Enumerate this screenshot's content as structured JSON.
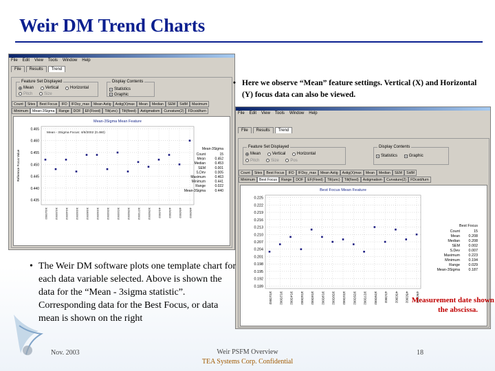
{
  "slide": {
    "title": "Weir DM Trend Charts",
    "bullet_right": "Here we observe “Mean” feature settings. Vertical (X) and Horizontal (Y) focus data can also be viewed.",
    "bullet_left": "The Weir DM software plots one template chart for each data variable selected. Above is shown the data for the “Mean - 3sigma statistic”. Corresponding data for the Best Focus, or data mean is shown on the right",
    "measurement_note": "Measurement date shown on the abscissa.",
    "bullet_glyph": "•"
  },
  "footer": {
    "date": "Nov. 2003",
    "center_line1": "Weir PSFM Overview",
    "center_line2": "TEA Systems Corp. Confidential",
    "page": "18"
  },
  "app_window": {
    "menu": [
      "File",
      "Edit",
      "View",
      "Tools",
      "Window",
      "Help"
    ],
    "tabs": [
      "File",
      "Results",
      "Trend"
    ],
    "active_tab": "Trend",
    "panel_label": "Trend Charts",
    "feature_group": {
      "label": "Feature Set Displayed",
      "options": [
        "Mean",
        "Vertical",
        "Horizontal",
        "Pitch",
        "Size",
        "Pos"
      ],
      "selected": "Mean"
    },
    "display_group": {
      "label": "Display Contents",
      "options": [
        "Statistics",
        "Graphic"
      ]
    },
    "variable_tabs_row1": [
      "Count",
      "Sites",
      "Best Focus",
      "IFD",
      "IFDsy_max",
      "Mean Astig",
      "Astig(X)max",
      "Mean",
      "Median",
      "SEM",
      "SidM",
      "Maximum"
    ],
    "variable_tabs_row2": [
      "Minimum",
      "Mean-3Sigma",
      "Range",
      "DOF",
      "EF(Fixed)",
      "Tilt(unc)",
      "Tilt(fixed)",
      "Astigmatism",
      "Curvature(2)",
      "FDcsid/turn"
    ]
  },
  "left_chart": {
    "title": "Mean-3Sigma Mean Feature",
    "annotation": "Mean - 3Sigma Focus: 4/6/2002 (0.460)",
    "stats_header": "Mean-3Sigma",
    "stats": [
      {
        "label": "Count",
        "value": "15"
      },
      {
        "label": "Mean",
        "value": "0.452"
      },
      {
        "label": "Median",
        "value": "0.453"
      },
      {
        "label": "SEM",
        "value": "0.001"
      },
      {
        "label": "S.Dev",
        "value": "0.005"
      },
      {
        "label": "Maximum",
        "value": "0.463"
      },
      {
        "label": "Minimum",
        "value": "0.441"
      },
      {
        "label": "Range",
        "value": "0.022"
      },
      {
        "label": "Mean-3Sigma",
        "value": "0.440"
      }
    ]
  },
  "right_chart": {
    "title": "Best Focus Mean Feature",
    "stats_header": "Best Focus",
    "stats": [
      {
        "label": "Count",
        "value": "15"
      },
      {
        "label": "Mean",
        "value": "0.208"
      },
      {
        "label": "Median",
        "value": "0.208"
      },
      {
        "label": "SEM",
        "value": "0.002"
      },
      {
        "label": "S.Dev",
        "value": "0.007"
      },
      {
        "label": "Maximum",
        "value": "0.223"
      },
      {
        "label": "Minimum",
        "value": "0.194"
      },
      {
        "label": "Range",
        "value": "0.029"
      },
      {
        "label": "Mean-3Sigma",
        "value": "0.187"
      }
    ]
  },
  "chart_data": [
    {
      "type": "scatter",
      "title": "Mean-3Sigma Mean Feature",
      "ylabel": "Reference Focus Value",
      "ylim": [
        0.433,
        0.466
      ],
      "yticks": [
        "0.465",
        "0.460",
        "0.455",
        "0.450",
        "0.445",
        "0.440",
        "0.435"
      ],
      "x": [
        "3/11/2002",
        "3/12/2002",
        "3/14/2002",
        "3/15/2002",
        "3/18/2002",
        "3/19/2002",
        "3/20/2002",
        "3/22/2002",
        "3/25/2002",
        "3/27/2002",
        "3/29/2002",
        "4/1/2002",
        "4/3/2002",
        "4/5/2002",
        "4/6/2002"
      ],
      "y": [
        0.452,
        0.448,
        0.452,
        0.447,
        0.454,
        0.454,
        0.448,
        0.455,
        0.447,
        0.451,
        0.449,
        0.452,
        0.454,
        0.45,
        0.46
      ],
      "grid": true
    },
    {
      "type": "scatter",
      "title": "Best Focus Mean Feature",
      "ylim": [
        0.188,
        0.226
      ],
      "yticks": [
        "0.225",
        "0.222",
        "0.219",
        "0.216",
        "0.213",
        "0.210",
        "0.207",
        "0.204",
        "0.201",
        "0.198",
        "0.195",
        "0.192",
        "0.189"
      ],
      "x": [
        "3/11/2002",
        "3/12/2002",
        "3/14/2002",
        "3/15/2002",
        "3/18/2002",
        "3/19/2002",
        "3/20/2002",
        "3/22/2002",
        "3/25/2002",
        "3/27/2002",
        "3/29/2002",
        "4/1/2002",
        "4/3/2002",
        "4/5/2002",
        "4/6/2002"
      ],
      "y": [
        0.203,
        0.206,
        0.209,
        0.204,
        0.212,
        0.209,
        0.207,
        0.208,
        0.206,
        0.203,
        0.213,
        0.207,
        0.212,
        0.208,
        0.21
      ],
      "grid": true
    }
  ]
}
